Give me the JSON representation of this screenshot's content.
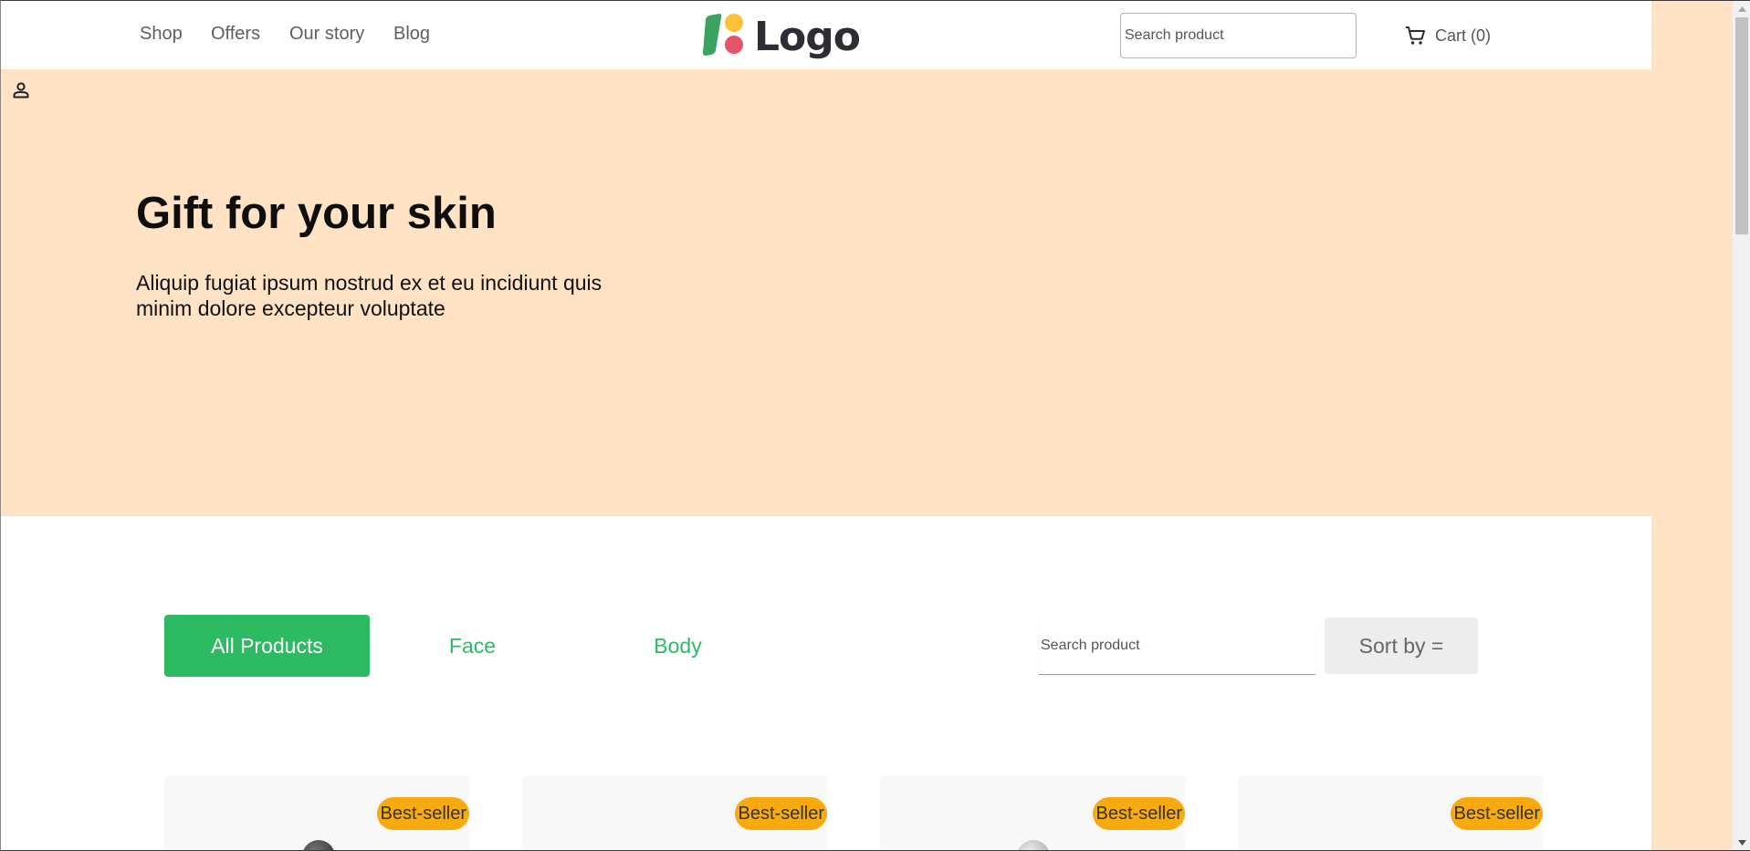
{
  "header": {
    "nav": [
      {
        "label": "Shop"
      },
      {
        "label": "Offers"
      },
      {
        "label": "Our story"
      },
      {
        "label": "Blog"
      }
    ],
    "logo_text": "Logo",
    "search_placeholder": "Search product",
    "cart_label": "Cart (0)"
  },
  "hero": {
    "title": "Gift for your skin",
    "subtitle": "Aliquip fugiat ipsum nostrud ex et eu incidiunt quis minim dolore excepteur voluptate"
  },
  "filters": {
    "tabs": [
      {
        "label": "All Products",
        "active": true
      },
      {
        "label": "Face",
        "active": false
      },
      {
        "label": "Body",
        "active": false
      }
    ],
    "search_placeholder": "Search product",
    "sort_label": "Sort by ="
  },
  "products": [
    {
      "badge": "Best-seller"
    },
    {
      "badge": "Best-seller"
    },
    {
      "badge": "Best-seller"
    },
    {
      "badge": "Best-seller"
    }
  ],
  "colors": {
    "accent_green": "#2dba63",
    "hero_bg": "#ffe3c4",
    "badge_orange": "#f8aa0f"
  },
  "icons": {
    "cart": "cart-icon",
    "account": "person-icon"
  }
}
